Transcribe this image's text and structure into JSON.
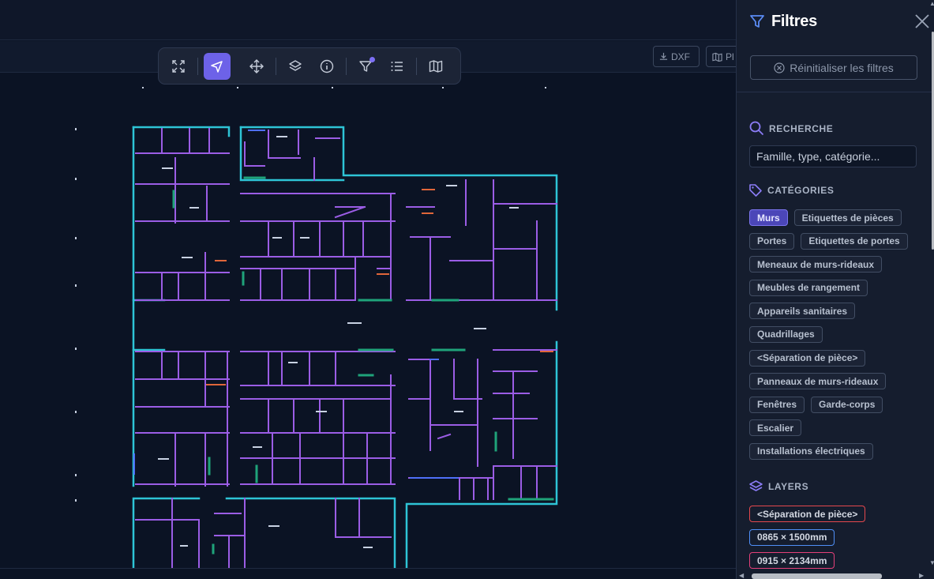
{
  "toolbar": {
    "tools": [
      {
        "name": "fullscreen",
        "icon": "expand-icon"
      },
      {
        "name": "select",
        "icon": "pointer-icon",
        "active": true
      },
      {
        "name": "pan",
        "icon": "move-icon"
      },
      {
        "name": "layers",
        "icon": "layers-icon"
      },
      {
        "name": "info",
        "icon": "info-icon"
      },
      {
        "name": "filter",
        "icon": "filter-icon",
        "badge": true
      },
      {
        "name": "list",
        "icon": "list-icon"
      },
      {
        "name": "map",
        "icon": "map-icon"
      }
    ]
  },
  "exports": {
    "dxf_label": "DXF",
    "plan_label": "Pl"
  },
  "panel": {
    "title": "Filtres",
    "reset_label": "Réinitialiser les filtres",
    "search": {
      "heading": "RECHERCHE",
      "placeholder": "Famille, type, catégorie..."
    },
    "categories": {
      "heading": "CATÉGORIES",
      "rows": [
        [
          {
            "label": "Murs",
            "selected": true
          },
          {
            "label": "Etiquettes de pièces"
          }
        ],
        [
          {
            "label": "Portes"
          },
          {
            "label": "Etiquettes de portes"
          }
        ],
        [
          {
            "label": "Meneaux de murs-rideaux"
          }
        ],
        [
          {
            "label": "Meubles de rangement"
          }
        ],
        [
          {
            "label": "Appareils sanitaires"
          }
        ],
        [
          {
            "label": "Quadrillages"
          }
        ],
        [
          {
            "label": "<Séparation de pièce>"
          }
        ],
        [
          {
            "label": "Panneaux de murs-rideaux"
          }
        ],
        [
          {
            "label": "Fenêtres"
          },
          {
            "label": "Garde-corps"
          }
        ],
        [
          {
            "label": "Escalier"
          }
        ],
        [
          {
            "label": "Installations électriques"
          }
        ]
      ]
    },
    "layers": {
      "heading": "LAYERS",
      "items": [
        {
          "label": "<Séparation de pièce>",
          "color": "#e5484d"
        },
        {
          "label": "0865 × 1500mm",
          "color": "#4f8ff7"
        },
        {
          "label": "0915 × 2134mm",
          "color": "#e5407a"
        }
      ]
    }
  },
  "colors": {
    "accent": "#6d62e8",
    "wall_interior": "#9b5de5",
    "wall_exterior": "#2ec4d6",
    "window": "#1fa37a",
    "door_highlight": "#e0663a"
  }
}
